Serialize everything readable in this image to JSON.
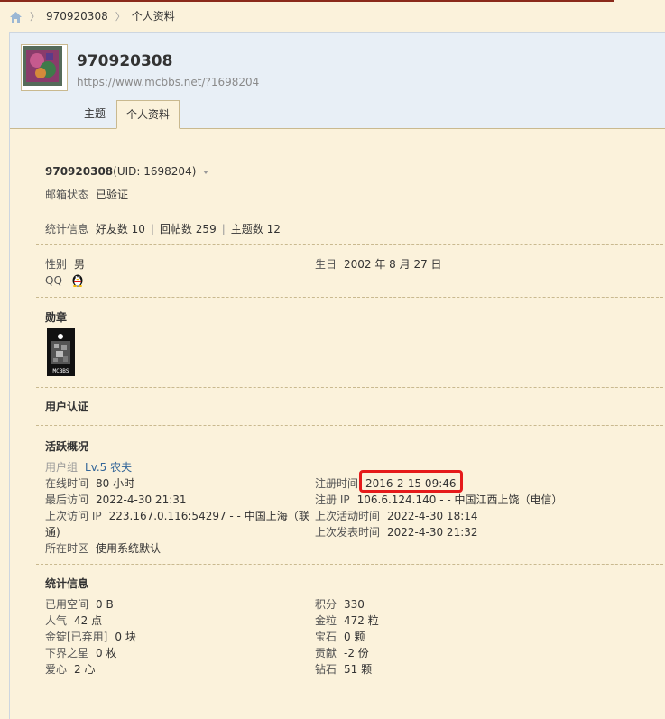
{
  "breadcrumb": {
    "items": [
      "970920308",
      "个人资料"
    ]
  },
  "profile": {
    "name": "970920308",
    "url": "https://www.mcbbs.net/?1698204",
    "tabs": [
      "主题",
      "个人资料"
    ],
    "active_tab": "个人资料"
  },
  "info": {
    "username": "970920308",
    "uid_text": "(UID: 1698204)",
    "email_label": "邮箱状态",
    "email_value": "已验证",
    "stats_label": "统计信息",
    "friends": "好友数 10",
    "replies": "回帖数 259",
    "threads": "主题数 12",
    "gender_label": "性别",
    "gender_value": "男",
    "birthday_label": "生日",
    "birthday_value": "2002 年 8 月 27 日",
    "qq_label": "QQ"
  },
  "medals": {
    "title": "勋章",
    "badge_text": "MCBBS"
  },
  "certification": {
    "title": "用户认证"
  },
  "activity": {
    "title": "活跃概况",
    "group_label": "用户组",
    "group_value": "Lv.5 农夫",
    "online_label": "在线时间",
    "online_value": "80 小时",
    "reg_label": "注册时间",
    "reg_value": "2016-2-15 09:46",
    "last_visit_label": "最后访问",
    "last_visit_value": "2022-4-30 21:31",
    "reg_ip_label": "注册 IP",
    "reg_ip_value": "106.6.124.140 - - 中国江西上饶（电信）",
    "last_ip_label": "上次访问 IP",
    "last_ip_value_1": "223.167.0.116:54297 - - 中国上海（联",
    "last_ip_value_2": "通)",
    "last_active_label": "上次活动时间",
    "last_active_value": "2022-4-30 18:14",
    "last_post_label": "上次发表时间",
    "last_post_value": "2022-4-30 21:32",
    "timezone_label": "所在时区",
    "timezone_value": "使用系统默认"
  },
  "stats": {
    "title": "统计信息",
    "left": [
      {
        "label": "已用空间",
        "value": "0 B"
      },
      {
        "label": "人气",
        "value": "42 点"
      },
      {
        "label": "金锭[已弃用]",
        "value": "0 块"
      },
      {
        "label": "下界之星",
        "value": "0 枚"
      },
      {
        "label": "爱心",
        "value": "2 心"
      }
    ],
    "right": [
      {
        "label": "积分",
        "value": "330"
      },
      {
        "label": "金粒",
        "value": "472 粒"
      },
      {
        "label": "宝石",
        "value": "0 颗"
      },
      {
        "label": "贡献",
        "value": "-2 份"
      },
      {
        "label": "钻石",
        "value": "51 颗"
      }
    ]
  },
  "colors": {
    "highlight": "#e51a1a",
    "link": "#336699",
    "page_bg": "#fbf2db"
  }
}
